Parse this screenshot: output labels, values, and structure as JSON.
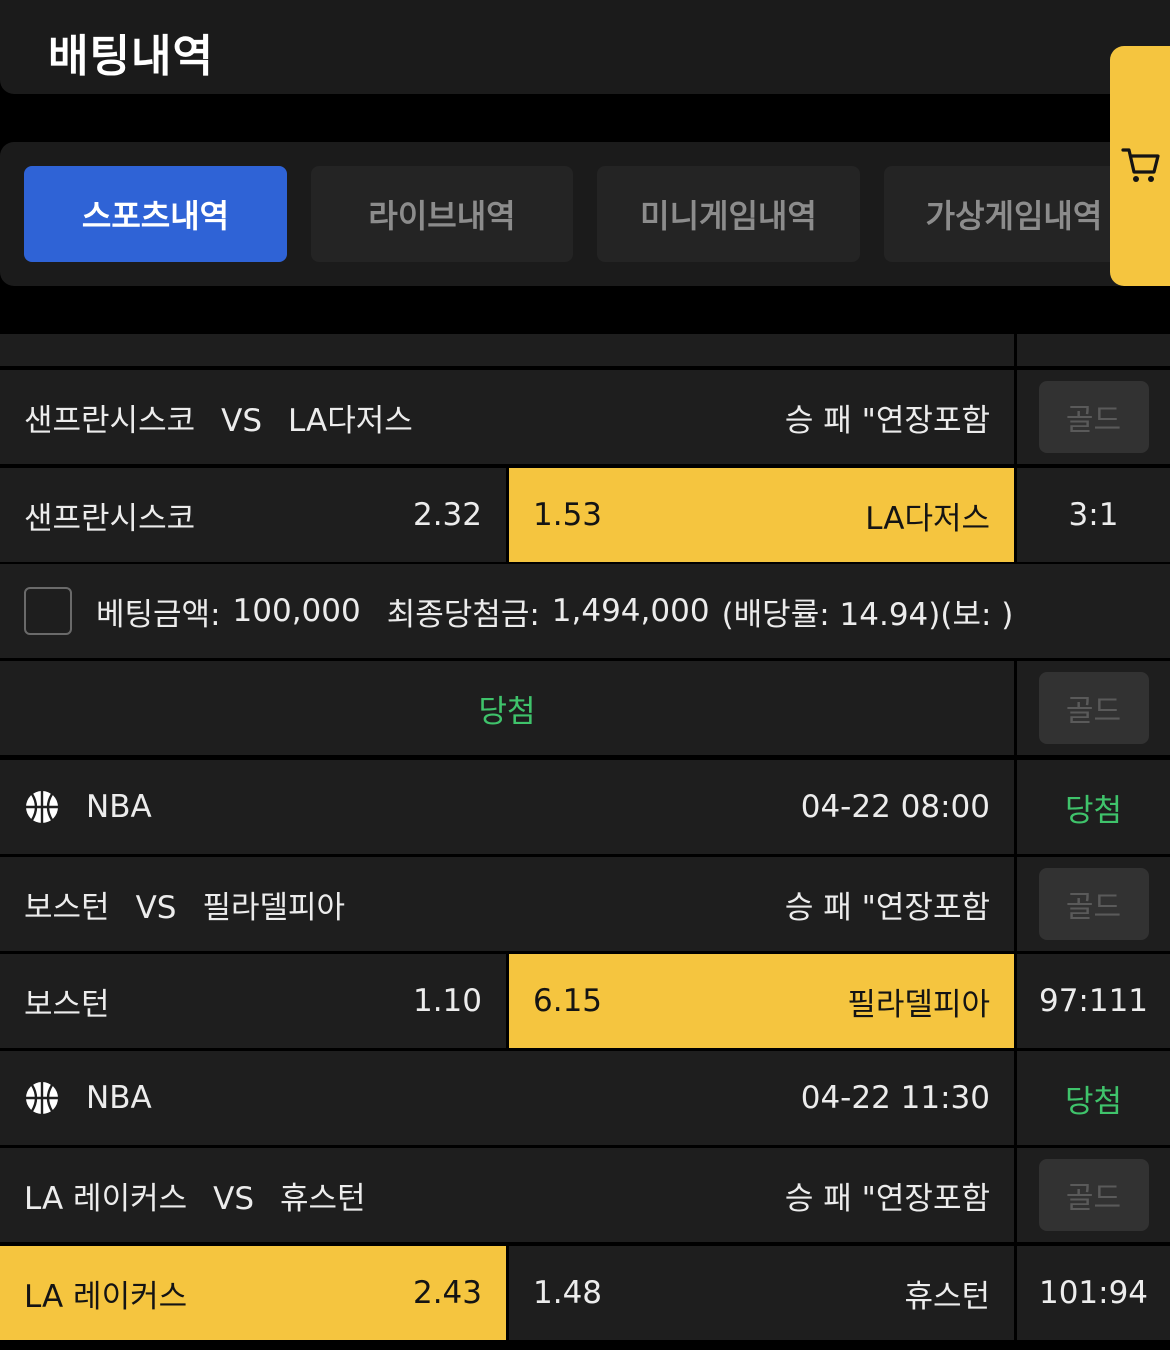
{
  "header": {
    "title": "배팅내역"
  },
  "tabs": [
    {
      "label": "스포츠내역",
      "active": true
    },
    {
      "label": "라이브내역",
      "active": false
    },
    {
      "label": "미니게임내역",
      "active": false
    },
    {
      "label": "가상게임내역",
      "active": false
    }
  ],
  "cart": {
    "icon": "cart-icon",
    "color": "#f5c53f"
  },
  "colors": {
    "accent_blue": "#2f63d6",
    "selected_yellow": "#f5c53f",
    "win_green": "#3fc36b"
  },
  "bets": [
    {
      "home": "샌프란시스코",
      "vs": "VS",
      "away": "LA다저스",
      "market": "승 패 \"연장포함",
      "gold_label": "골드",
      "home_odds": "2.32",
      "away_odds": "1.53",
      "selected": "away",
      "score": "3:1"
    },
    {
      "league_icon": "basketball-icon",
      "league": "NBA",
      "datetime": "04-22 08:00",
      "result": "당첨",
      "home": "보스턴",
      "vs": "VS",
      "away": "필라델피아",
      "market": "승 패 \"연장포함",
      "gold_label": "골드",
      "home_odds": "1.10",
      "away_odds": "6.15",
      "selected": "away",
      "score": "97:111"
    },
    {
      "league_icon": "basketball-icon",
      "league": "NBA",
      "datetime": "04-22 11:30",
      "result": "당첨",
      "home": "LA 레이커스",
      "vs": "VS",
      "away": "휴스턴",
      "market": "승 패 \"연장포함",
      "gold_label": "골드",
      "home_odds": "2.43",
      "away_odds": "1.48",
      "selected": "home",
      "score": "101:94"
    }
  ],
  "summary": {
    "bet_label": "베팅금액:",
    "bet_amount": "100,000",
    "payout_label": "최종당첨금:",
    "payout_amount": "1,494,000",
    "odds_text": "(배당률: 14.94)(보: )",
    "result": "당첨",
    "gold_label": "골드"
  }
}
